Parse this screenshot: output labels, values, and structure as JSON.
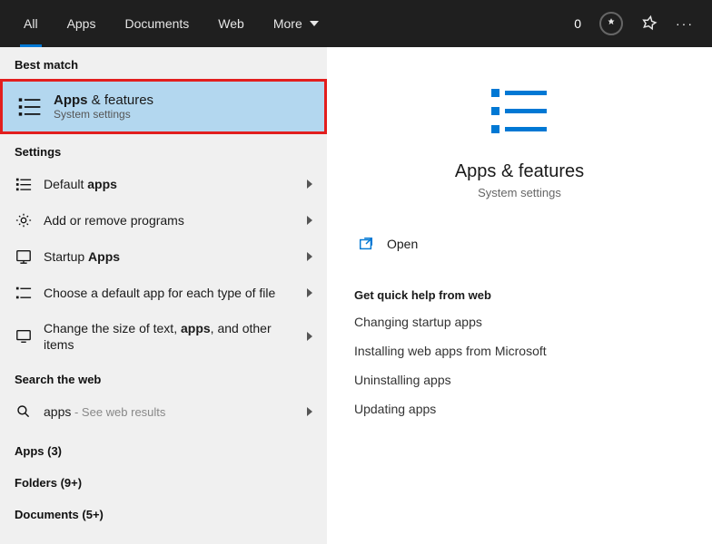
{
  "topbar": {
    "tabs": [
      "All",
      "Apps",
      "Documents",
      "Web",
      "More"
    ],
    "count": "0"
  },
  "left": {
    "best_match_header": "Best match",
    "best_match": {
      "title_prefix": "Apps",
      "title_suffix": " & features",
      "subtitle": "System settings"
    },
    "settings_header": "Settings",
    "settings_items": [
      {
        "pre": "Default ",
        "bold": "apps",
        "post": "",
        "icon": "default-apps-icon"
      },
      {
        "pre": "Add or remove programs",
        "bold": "",
        "post": "",
        "icon": "gear-icon"
      },
      {
        "pre": "Startup ",
        "bold": "Apps",
        "post": "",
        "icon": "startup-icon"
      },
      {
        "pre": "Choose a default app for each type of file",
        "bold": "",
        "post": "",
        "icon": "file-default-icon"
      },
      {
        "pre": "Change the size of text, ",
        "bold": "apps",
        "post": ", and other items",
        "icon": "display-icon"
      }
    ],
    "web_header": "Search the web",
    "web_item": {
      "query": "apps",
      "suffix": " - See web results"
    },
    "categories": [
      "Apps (3)",
      "Folders (9+)",
      "Documents (5+)"
    ]
  },
  "right": {
    "title": "Apps & features",
    "subtitle": "System settings",
    "open_label": "Open",
    "quick_header": "Get quick help from web",
    "quick_links": [
      "Changing startup apps",
      "Installing web apps from Microsoft",
      "Uninstalling apps",
      "Updating apps"
    ]
  }
}
